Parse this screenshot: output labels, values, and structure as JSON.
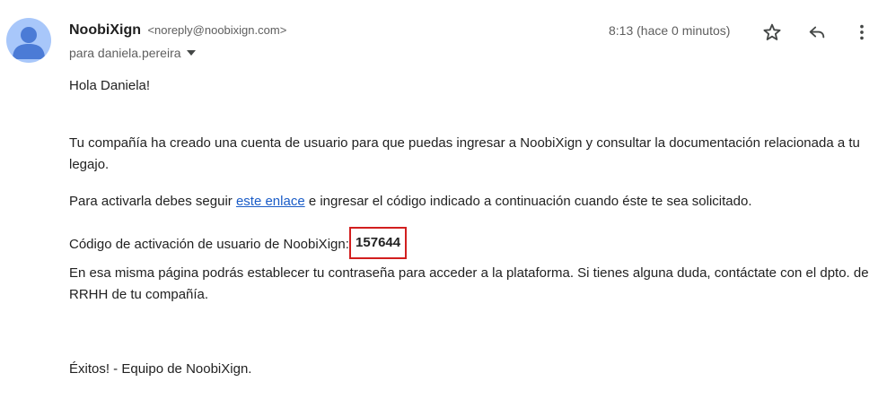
{
  "email": {
    "sender_name": "NoobiXign",
    "sender_email": "<noreply@noobixign.com>",
    "recipient": "para daniela.pereira",
    "timestamp": "8:13 (hace 0 minutos)"
  },
  "body": {
    "greeting": "Hola Daniela!",
    "intro": "Tu compañía ha creado una cuenta de usuario para que puedas ingresar a NoobiXign y consultar la documentación relacionada a tu legajo.",
    "activate_before": "Para activarla debes seguir ",
    "activate_link": "este enlace",
    "activate_after": " e ingresar el código indicado a continuación cuando éste te sea solicitado.",
    "code_label": "Código de activación de usuario de NoobiXign: ",
    "code_value": "157644",
    "info": "En esa misma página podrás establecer tu contraseña para acceder a la plataforma. Si tienes alguna duda, contáctate con el dpto. de RRHH de tu compañía.",
    "signoff": "Éxitos! - Equipo de NoobiXign."
  },
  "icons": {
    "avatar": "person-avatar-icon",
    "recipient_toggle": "caret-down-icon",
    "star": "star-icon",
    "reply": "reply-icon",
    "more": "more-vert-icon"
  },
  "colors": {
    "avatar_bg": "#a8c7fa",
    "avatar_fg": "#4b7bd6",
    "link": "#1a5cc7",
    "highlight_border": "#d21f1f"
  }
}
